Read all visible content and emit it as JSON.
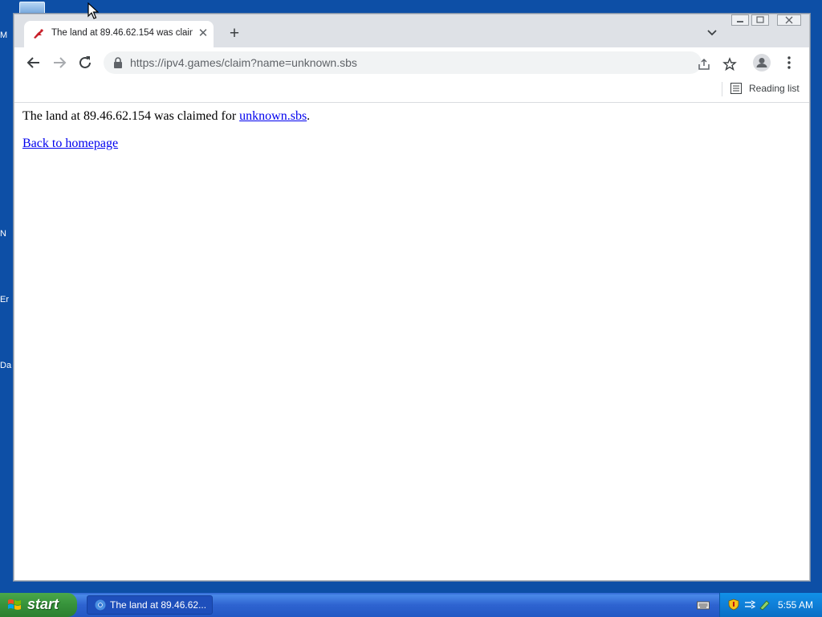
{
  "desktop": {
    "icon_labels": [
      "M",
      "N",
      "Er",
      "Da"
    ]
  },
  "browser": {
    "tab": {
      "title": "The land at 89.46.62.154 was claim",
      "close_glyph": "✕"
    },
    "new_tab_glyph": "+",
    "omnibox": {
      "url": "https://ipv4.games/claim?name=unknown.sbs"
    },
    "bookmarks_bar": {
      "reading_list_label": "Reading list"
    }
  },
  "page": {
    "line1_prefix": "The land at 89.46.62.154 was claimed for ",
    "claim_link": "unknown.sbs",
    "line1_suffix": ".",
    "back_link": "Back to homepage"
  },
  "taskbar": {
    "start_label": "start",
    "task_button_label": "The land at 89.46.62...",
    "clock": "5:55 AM"
  },
  "colors": {
    "desktop": "#0d4fa6",
    "link": "#0000ee",
    "start_green": "#36923a",
    "taskbar_blue": "#2e63d0",
    "tray_blue": "#0f7fd8"
  }
}
